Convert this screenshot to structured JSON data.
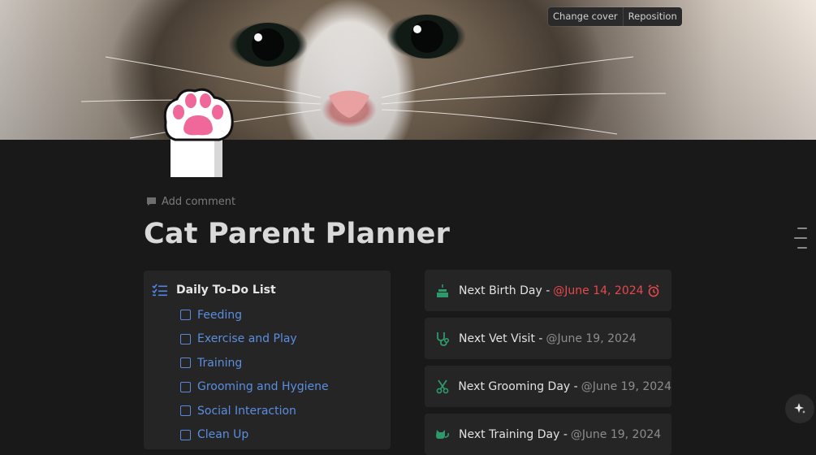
{
  "cover": {
    "change_cover_label": "Change cover",
    "reposition_label": "Reposition"
  },
  "page": {
    "icon": "cat-paw-icon",
    "add_comment_label": "Add comment",
    "title": "Cat Parent Planner"
  },
  "todo": {
    "icon": "checklist-icon",
    "title": "Daily To-Do List",
    "items": [
      {
        "label": "Feeding",
        "checked": false
      },
      {
        "label": "Exercise and Play",
        "checked": false
      },
      {
        "label": "Training",
        "checked": false
      },
      {
        "label": "Grooming and Hygiene",
        "checked": false
      },
      {
        "label": "Social Interaction",
        "checked": false
      },
      {
        "label": "Clean Up",
        "checked": false
      }
    ]
  },
  "events": [
    {
      "icon": "cake-icon",
      "icon_color": "#2e9a6b",
      "label": "Next Birth Day -",
      "date": "@June 14, 2024",
      "date_color": "#e5484d",
      "alarm": true
    },
    {
      "icon": "stethoscope-icon",
      "icon_color": "#2e9a6b",
      "label": "Next Vet Visit -",
      "date": "@June 19, 2024"
    },
    {
      "icon": "scissors-icon",
      "icon_color": "#2e9a6b",
      "label": "Next Grooming Day -",
      "date": "@June 19, 2024"
    },
    {
      "icon": "cat-icon",
      "icon_color": "#2e9a6b",
      "label": "Next Training Day -",
      "date": "@June 19, 2024"
    }
  ],
  "colors": {
    "background": "#191919",
    "card": "#252525",
    "link_blue": "#5b8ee0",
    "accent_green": "#2e9a6b",
    "alert_red": "#e5484d"
  }
}
